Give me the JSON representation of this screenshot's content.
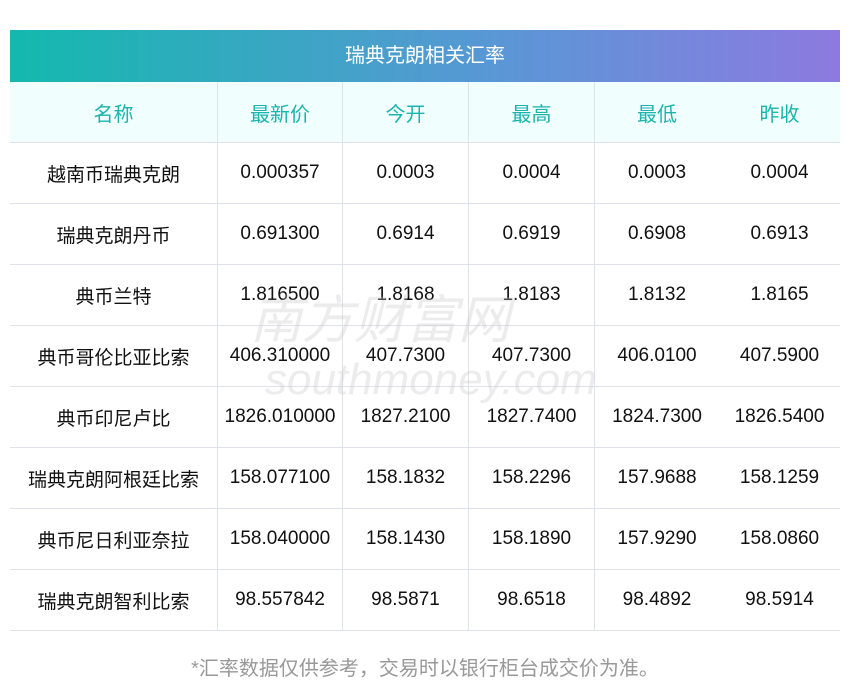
{
  "title": "瑞典克朗相关汇率",
  "headers": [
    "名称",
    "最新价",
    "今开",
    "最高",
    "最低",
    "昨收"
  ],
  "rows": [
    [
      "越南币瑞典克朗",
      "0.000357",
      "0.0003",
      "0.0004",
      "0.0003",
      "0.0004"
    ],
    [
      "瑞典克朗丹币",
      "0.691300",
      "0.6914",
      "0.6919",
      "0.6908",
      "0.6913"
    ],
    [
      "典币兰特",
      "1.816500",
      "1.8168",
      "1.8183",
      "1.8132",
      "1.8165"
    ],
    [
      "典币哥伦比亚比索",
      "406.310000",
      "407.7300",
      "407.7300",
      "406.0100",
      "407.5900"
    ],
    [
      "典币印尼卢比",
      "1826.010000",
      "1827.2100",
      "1827.7400",
      "1824.7300",
      "1826.5400"
    ],
    [
      "瑞典克朗阿根廷比索",
      "158.077100",
      "158.1832",
      "158.2296",
      "157.9688",
      "158.1259"
    ],
    [
      "典币尼日利亚奈拉",
      "158.040000",
      "158.1430",
      "158.1890",
      "157.9290",
      "158.0860"
    ],
    [
      "瑞典克朗智利比索",
      "98.557842",
      "98.5871",
      "98.6518",
      "98.4892",
      "98.5914"
    ]
  ],
  "watermark": {
    "cn": "南方财富网",
    "en": "southmoney.com"
  },
  "footer": "*汇率数据仅供参考，交易时以银行柜台成交价为准。"
}
